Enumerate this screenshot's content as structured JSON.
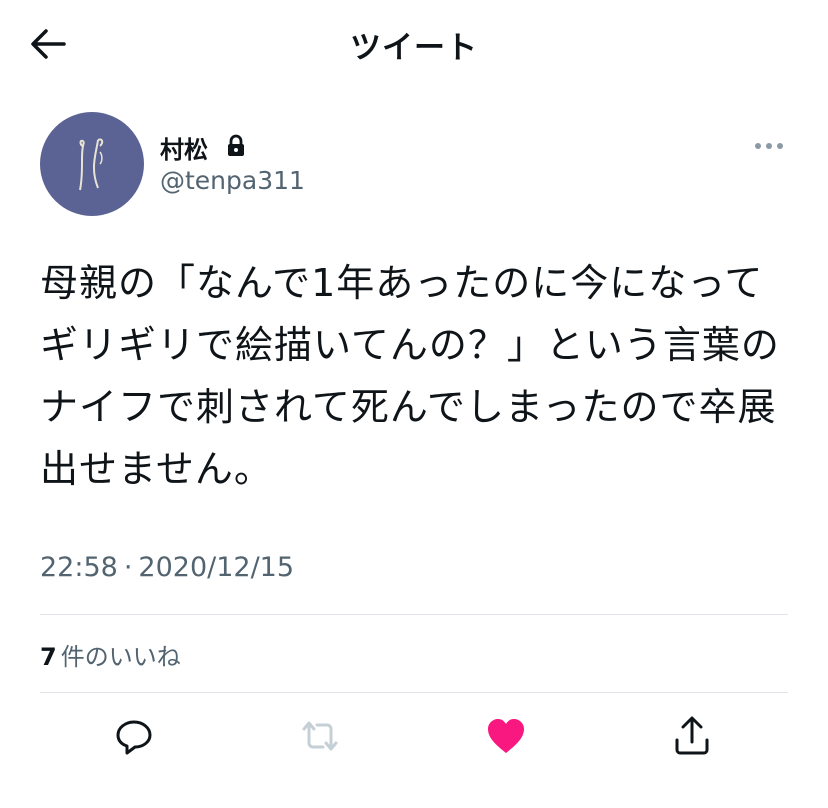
{
  "header": {
    "title": "ツイート",
    "back_icon": "arrow-left-icon"
  },
  "author": {
    "display_name": "村松",
    "handle": "@tenpa311",
    "protected_icon": "lock-icon",
    "avatar_color": "#5b6394"
  },
  "tweet": {
    "text": "母親の「なんで1年あったのに今になってギリギリで絵描いてんの？」という言葉のナイフで刺されて死んでしまったので卒展出せません。",
    "time": "22:58",
    "separator": "·",
    "date": "2020/12/15"
  },
  "stats": {
    "likes_count": "7",
    "likes_label": "件のいいね"
  },
  "actions": {
    "reply_icon": "reply-icon",
    "retweet_icon": "retweet-icon",
    "like_icon": "heart-icon",
    "share_icon": "share-icon",
    "like_color": "#f91880",
    "retweet_disabled_color": "#c4cfd6"
  }
}
